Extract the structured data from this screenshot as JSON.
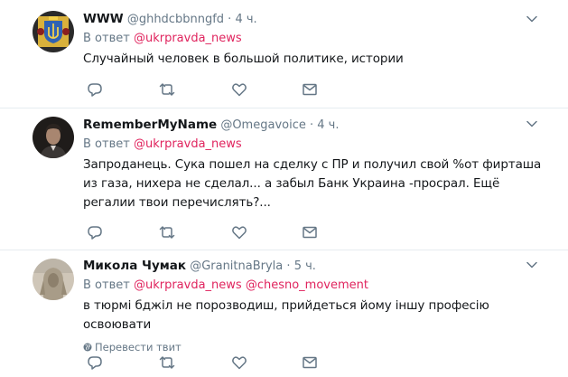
{
  "tweets": [
    {
      "display_name": "WWW",
      "handle": "@ghhdcbbnngfd",
      "dot": "·",
      "time": "4 ч.",
      "reply_prefix": "В ответ ",
      "mentions": [
        "@ukrpravda_news"
      ],
      "text": "Случайный человек в большой политике, истории",
      "avatar": "coat-of-arms-avatar",
      "translate_label": ""
    },
    {
      "display_name": "RememberMyName",
      "handle": "@Omegavoice",
      "dot": "·",
      "time": "4 ч.",
      "reply_prefix": "В ответ ",
      "mentions": [
        "@ukrpravda_news"
      ],
      "text": "Запроданець. Сука пошел на сделку с ПР и получил свой %от фирташа  из газа, нихера не сделал... а забыл Банк Украина -просрал. Ещё регалии твои перечислять?...",
      "avatar": "man-portrait-avatar",
      "translate_label": ""
    },
    {
      "display_name": "Микола Чумак",
      "handle": "@GranitnaBryla",
      "dot": "·",
      "time": "5 ч.",
      "reply_prefix": "В ответ ",
      "mentions": [
        "@ukrpravda_news",
        "@chesno_movement"
      ],
      "text": "в тюрмі бджіл не порозводиш, прийдеться йому іншу професію освоювати",
      "avatar": "sphinx-avatar",
      "translate_label": "Перевести твит"
    }
  ],
  "colors": {
    "accent": "#e0245e",
    "secondary_text": "#657786",
    "icon": "#657786",
    "divider": "#e6ecf0"
  },
  "icons": [
    "reply-icon",
    "retweet-icon",
    "like-icon",
    "direct-message-icon",
    "chevron-down-icon",
    "globe-icon"
  ]
}
